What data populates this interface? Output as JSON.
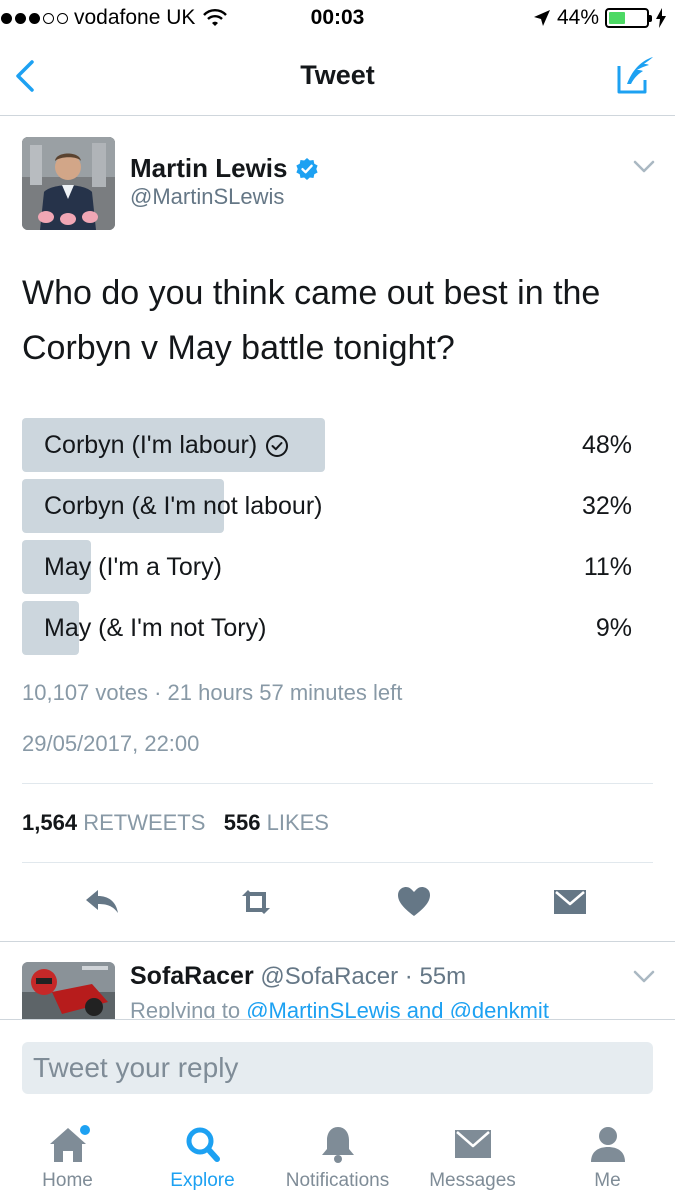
{
  "status_bar": {
    "carrier": "vodafone UK",
    "time": "00:03",
    "battery": "44%",
    "battery_level": 0.44
  },
  "nav": {
    "title": "Tweet"
  },
  "tweet": {
    "author_name": "Martin Lewis",
    "author_handle": "@MartinSLewis",
    "text_line1": "Who do you think came out best in the",
    "text_line2": "Corbyn v May battle tonight?",
    "poll": {
      "options": [
        {
          "label": "Corbyn (I'm labour)",
          "percent": 48,
          "percent_text": "48%",
          "selected": true
        },
        {
          "label": "Corbyn (& I'm not labour)",
          "percent": 32,
          "percent_text": "32%",
          "selected": false
        },
        {
          "label": "May (I'm a Tory)",
          "percent": 11,
          "percent_text": "11%",
          "selected": false
        },
        {
          "label": "May (& I'm not Tory)",
          "percent": 9,
          "percent_text": "9%",
          "selected": false
        }
      ],
      "meta": "10,107 votes · 21 hours 57 minutes left"
    },
    "date": "29/05/2017, 22:00",
    "retweets_count": "1,564",
    "retweets_label": "RETWEETS",
    "likes_count": "556",
    "likes_label": "LIKES"
  },
  "reply_preview": {
    "name": "SofaRacer",
    "handle": "@SofaRacer",
    "time": "· 55m",
    "replying_prefix": "Replying to",
    "replying_user1": "@MartinSLewis",
    "replying_and": "and",
    "replying_user2": "@denkmit"
  },
  "reply_box": {
    "placeholder": "Tweet your reply"
  },
  "tabs": [
    {
      "label": "Home",
      "icon": "home-icon"
    },
    {
      "label": "Explore",
      "icon": "search-icon"
    },
    {
      "label": "Notifications",
      "icon": "bell-icon"
    },
    {
      "label": "Messages",
      "icon": "envelope-icon"
    },
    {
      "label": "Me",
      "icon": "person-icon"
    }
  ],
  "colors": {
    "accent": "#1da1f2",
    "poll_bar": "#ccd6dd",
    "muted_text": "#8899a6",
    "battery_green": "#4cd964"
  }
}
